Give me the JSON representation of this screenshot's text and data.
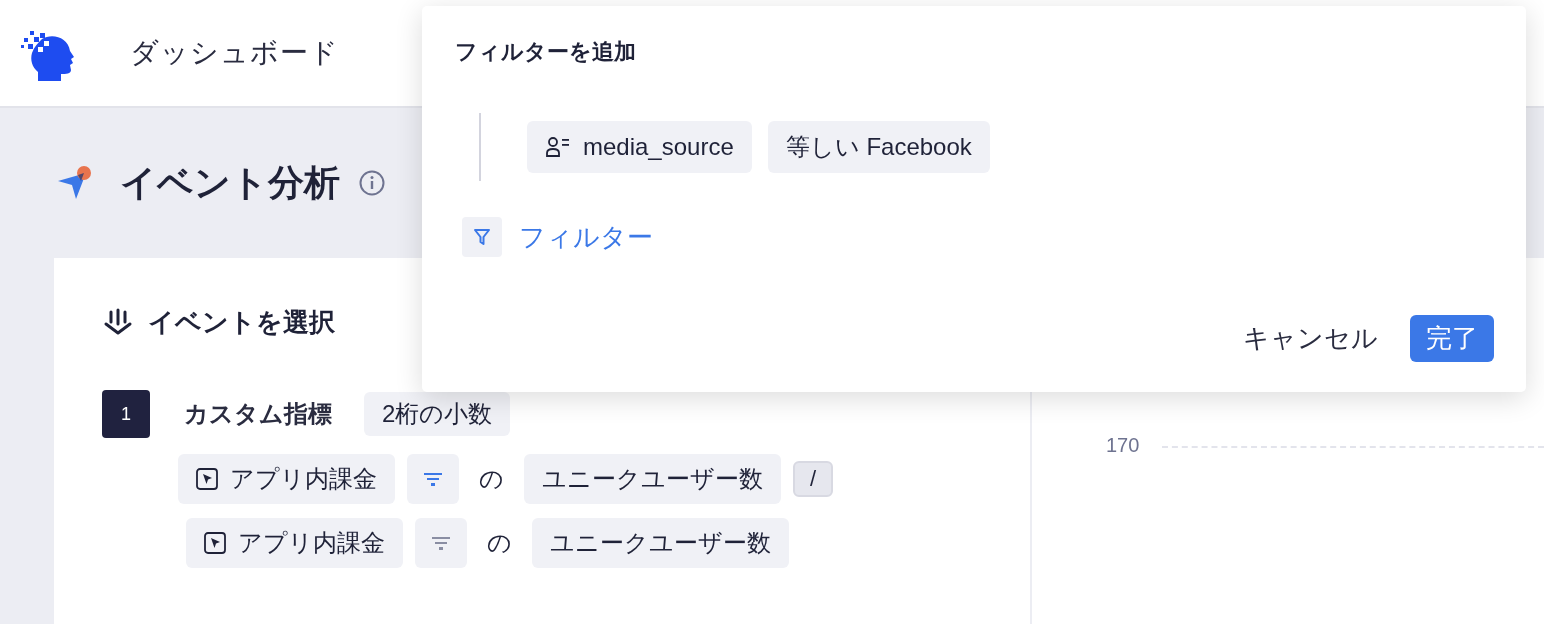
{
  "header": {
    "title": "ダッシュボード"
  },
  "page_title": "イベント分析",
  "event_section": {
    "heading": "イベントを選択",
    "metrics": [
      {
        "number": "1",
        "name": "カスタム指標",
        "format": "2桁の小数",
        "terms": [
          {
            "event": "アプリ内課金",
            "filter_active": true,
            "connector": "の",
            "measure": "ユニークユーザー数",
            "operator": "/"
          },
          {
            "event": "アプリ内課金",
            "filter_active": false,
            "connector": "の",
            "measure": "ユニークユーザー数"
          }
        ]
      }
    ]
  },
  "chart_panel": {
    "y_tick": "170"
  },
  "filter_popover": {
    "title": "フィルターを追加",
    "conditions": [
      {
        "property": "media_source",
        "condition": "等しい Facebook"
      }
    ],
    "add_filter_label": "フィルター",
    "buttons": [
      {
        "label": "キャンセル",
        "kind": "secondary"
      },
      {
        "label": "完了",
        "kind": "primary"
      }
    ]
  }
}
